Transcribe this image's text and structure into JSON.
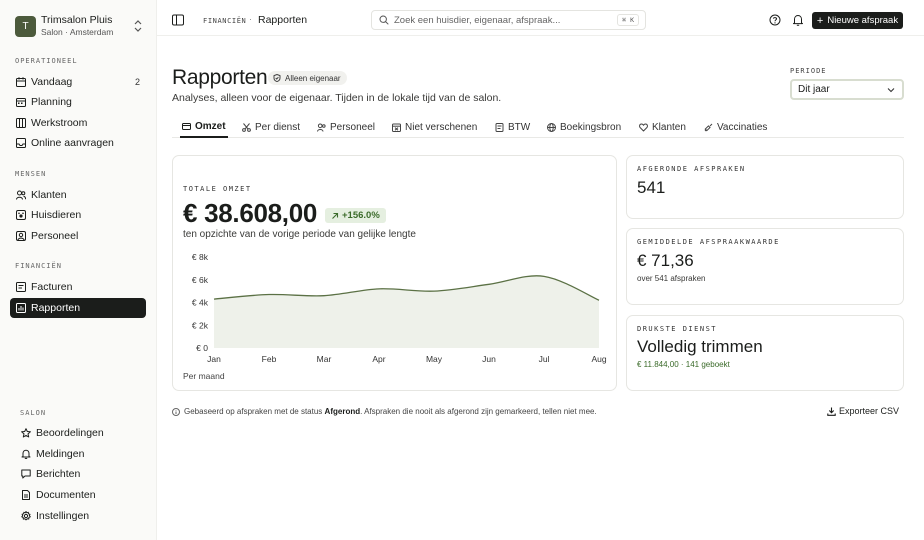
{
  "app": {
    "avatar_letter": "T",
    "name": "Trimsalon Pluis",
    "subtitle": "Salon · Amsterdam"
  },
  "sidebar": {
    "sections": {
      "operationeel": "OPERATIONEEL",
      "mensen": "MENSEN",
      "financien": "FINANCIËN",
      "salon": "SALON"
    },
    "operationeel": [
      {
        "label": "Vandaag",
        "icon": "calendar-day-icon",
        "count": "2"
      },
      {
        "label": "Planning",
        "icon": "calendar-icon"
      },
      {
        "label": "Werkstroom",
        "icon": "board-icon"
      },
      {
        "label": "Online aanvragen",
        "icon": "inbox-icon"
      }
    ],
    "mensen": [
      {
        "label": "Klanten",
        "icon": "users-icon"
      },
      {
        "label": "Huisdieren",
        "icon": "paw-icon"
      },
      {
        "label": "Personeel",
        "icon": "user-icon"
      }
    ],
    "financien": [
      {
        "label": "Facturen",
        "icon": "receipt-icon"
      },
      {
        "label": "Rapporten",
        "icon": "chart-icon",
        "active": true
      }
    ],
    "salon": [
      {
        "label": "Beoordelingen",
        "icon": "star-icon"
      },
      {
        "label": "Meldingen",
        "icon": "bell-icon"
      },
      {
        "label": "Berichten",
        "icon": "message-icon"
      },
      {
        "label": "Documenten",
        "icon": "document-icon"
      },
      {
        "label": "Instellingen",
        "icon": "gear-icon"
      }
    ]
  },
  "topbar": {
    "breadcrumb_section": "FINANCIËN",
    "breadcrumb_separator": "·",
    "breadcrumb_current": "Rapporten",
    "search_placeholder": "Zoek een huisdier, eigenaar, afspraak...",
    "search_shortcut": "⌘ K",
    "new_button": "Nieuwe afspraak"
  },
  "page": {
    "title": "Rapporten",
    "owner_chip": "Alleen eigenaar",
    "subtitle": "Analyses, alleen voor de eigenaar. Tijden in de lokale tijd van de salon.",
    "periode_label": "PERIODE",
    "periode_value": "Dit jaar",
    "tabs": [
      {
        "label": "Omzet",
        "icon": "wallet-icon",
        "active": true
      },
      {
        "label": "Per dienst",
        "icon": "scissors-icon"
      },
      {
        "label": "Personeel",
        "icon": "users-icon"
      },
      {
        "label": "Niet verschenen",
        "icon": "calendar-x-icon"
      },
      {
        "label": "BTW",
        "icon": "receipt-icon"
      },
      {
        "label": "Boekingsbron",
        "icon": "globe-icon"
      },
      {
        "label": "Klanten",
        "icon": "heart-icon"
      },
      {
        "label": "Vaccinaties",
        "icon": "syringe-icon"
      }
    ]
  },
  "revenue_card": {
    "label": "TOTALE OMZET",
    "amount": "€ 38.608,00",
    "growth": "+156.0%",
    "compare": "ten opzichte van de vorige periode van gelijke lengte",
    "per": "Per maand"
  },
  "chart_data": {
    "type": "area",
    "categories": [
      "Jan",
      "Feb",
      "Mar",
      "Apr",
      "May",
      "Jun",
      "Jul",
      "Aug"
    ],
    "values": [
      4300,
      4700,
      4600,
      5200,
      5000,
      5600,
      6300,
      4200
    ],
    "y_ticks": [
      "€ 0",
      "€ 2k",
      "€ 4k",
      "€ 6k",
      "€ 8k"
    ],
    "ylim": [
      0,
      8000
    ],
    "color": "#5b7145"
  },
  "stats": [
    {
      "label": "AFGERONDE AFSPRAKEN",
      "value": "541"
    },
    {
      "label": "GEMIDDELDE AFSPRAAKWAARDE",
      "value": "€ 71,36",
      "note": "over 541 afspraken"
    },
    {
      "label": "DRUKSTE DIENST",
      "value": "Volledig trimmen",
      "note": "€ 11.844,00 · 141 geboekt"
    }
  ],
  "footer": {
    "info_prefix": "Gebaseerd op afspraken met de status",
    "info_bold": "Afgerond",
    "info_suffix": ". Afspraken die nooit als afgerond zijn gemarkeerd, tellen niet mee.",
    "export": "Exporteer CSV"
  }
}
